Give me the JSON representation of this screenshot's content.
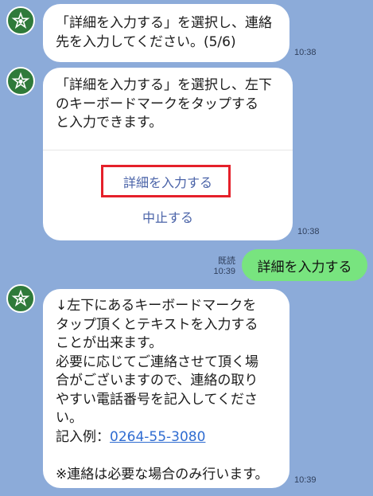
{
  "messages": [
    {
      "text": "「詳細を入力する」を選択し、連絡\n先を入力してください。(5/6)",
      "time": "10:38"
    },
    {
      "text": "「詳細を入力する」を選択し、左下\nのキーボードマークをタップする\nと入力できます。",
      "actions": [
        "詳細を入力する",
        "中止する"
      ],
      "time": "10:38"
    },
    {
      "sent_text": "詳細を入力する",
      "read_label": "既読",
      "time": "10:39"
    },
    {
      "text_before_link": "↓左下にあるキーボードマークを\nタップ頂くとテキストを入力する\nことが出来ます。\n必要に応じてご連絡させて頂く場\n合がございますので、連絡の取り\nやすい電話番号を記入してくださ\nい。\n記入例：",
      "link": "0264-55-3080",
      "text_after_link": "\n\n※連絡は必要な場合のみ行います。",
      "time": "10:39"
    }
  ],
  "colors": {
    "background": "#8cabd9",
    "sent_bubble": "#78e47f",
    "highlight": "#e5202a",
    "action_text": "#4a63a8",
    "link": "#2f6cd1"
  },
  "icons": {
    "avatar": "star-emblem-icon"
  }
}
